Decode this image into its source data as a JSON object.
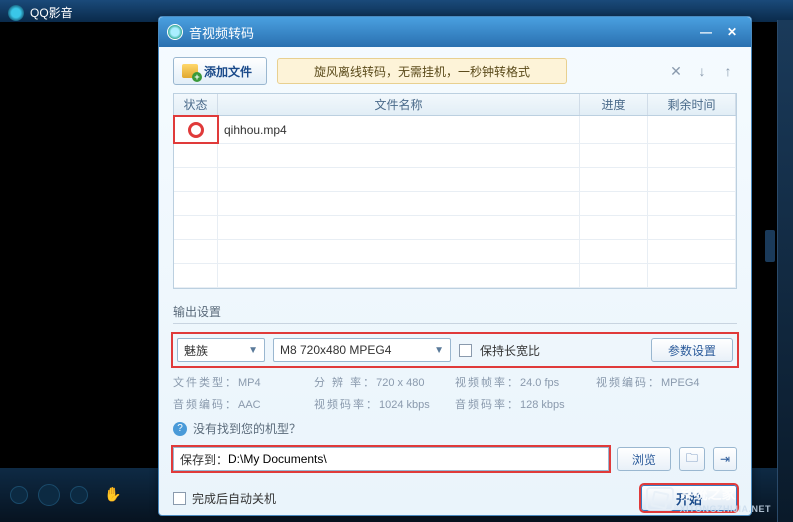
{
  "player": {
    "title": "QQ影音"
  },
  "dialog": {
    "title": "音视频转码",
    "addFileLabel": "添加文件",
    "promoText": "旋风离线转码，无需挂机，一秒钟转格式",
    "columns": {
      "status": "状态",
      "name": "文件名称",
      "progress": "进度",
      "time": "剩余时间"
    },
    "files": [
      {
        "name": "qihhou.mp4"
      }
    ],
    "outputSectionTitle": "输出设置",
    "brandSelect": "魅族",
    "modelSelect": "M8 720x480 MPEG4",
    "keepAspectLabel": "保持长宽比",
    "paramBtn": "参数设置",
    "meta": {
      "fileTypeK": "文件类型：",
      "fileTypeV": "MP4",
      "resK": "分 辨 率：",
      "resV": "720 x 480",
      "vfpsK": "视频帧率：",
      "vfpsV": "24.0 fps",
      "vcodecK": "视频编码：",
      "vcodecV": "MPEG4",
      "acodecK": "音频编码：",
      "acodecV": "AAC",
      "vbitK": "视频码率：",
      "vbitV": "1024 kbps",
      "abitK": "音频码率：",
      "abitV": "128 kbps"
    },
    "helpText": "没有找到您的机型？",
    "saveToLabel": "保存到：",
    "savePath": "D:\\My Documents\\",
    "browseLabel": "浏览",
    "shutdownLabel": "完成后自动关机",
    "startLabel": "开始"
  },
  "watermark": {
    "top": "系统之家",
    "bottom": "XITONGZHIJIA.NET"
  }
}
